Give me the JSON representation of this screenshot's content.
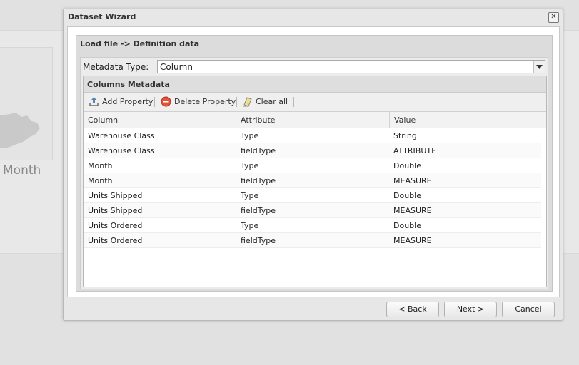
{
  "background": {
    "tile_label": "Month"
  },
  "window": {
    "title": "Dataset Wizard",
    "close_glyph": "✕",
    "panel_title": "Load file -> Definition data",
    "metadata_type": {
      "label": "Metadata Type:",
      "value": "Column"
    },
    "grid": {
      "title": "Columns Metadata",
      "toolbar": {
        "add": "Add Property",
        "delete": "Delete Property",
        "clear": "Clear all"
      },
      "columns": [
        "Column",
        "Attribute",
        "Value"
      ],
      "rows": [
        [
          "Warehouse Class",
          "Type",
          "String"
        ],
        [
          "Warehouse Class",
          "fieldType",
          "ATTRIBUTE"
        ],
        [
          "Month",
          "Type",
          "Double"
        ],
        [
          "Month",
          "fieldType",
          "MEASURE"
        ],
        [
          "Units Shipped",
          "Type",
          "Double"
        ],
        [
          "Units Shipped",
          "fieldType",
          "MEASURE"
        ],
        [
          "Units Ordered",
          "Type",
          "Double"
        ],
        [
          "Units Ordered",
          "fieldType",
          "MEASURE"
        ]
      ]
    },
    "buttons": {
      "back": "< Back",
      "next": "Next >",
      "cancel": "Cancel"
    }
  }
}
